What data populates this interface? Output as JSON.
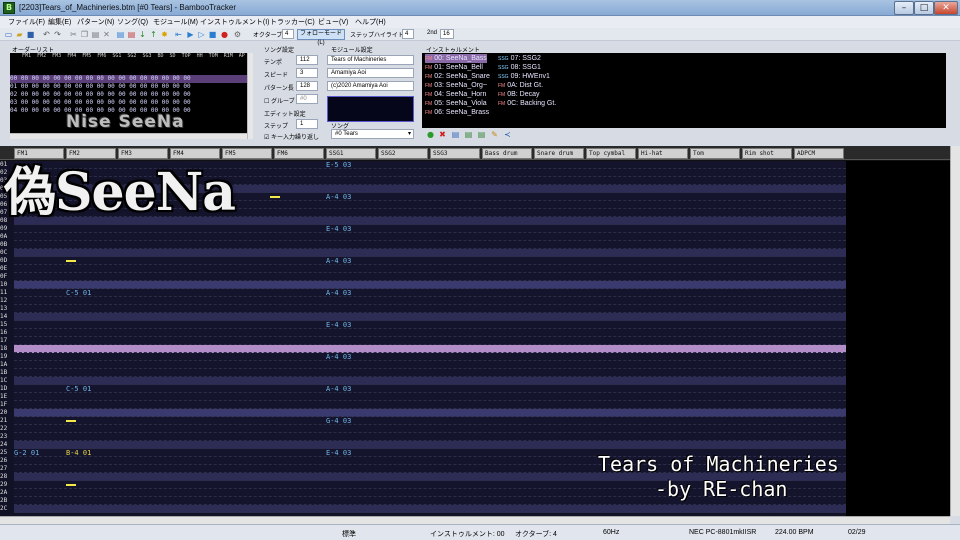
{
  "window": {
    "title": "[2203]Tears_of_Machineries.btm [#0 Tears] - BambooTracker",
    "app_icon": "B"
  },
  "menu": [
    "ファイル(F)",
    "編集(E)",
    "パターン(N)",
    "ソング(Q)",
    "モジュール(M)",
    "インストゥルメント(I)",
    "トラッカー(C)",
    "ビュー(V)",
    "ヘルプ(H)"
  ],
  "toolbar": {
    "octave_label": "オクターブ",
    "octave_value": "4",
    "follow_mode": "フォローモード(L)",
    "step_highlight_label": "ステップハイライト 1st",
    "step_highlight_1st": "4",
    "second_label": "2nd",
    "step_highlight_2nd": "16"
  },
  "order_list": {
    "label": "オーダーリスト",
    "header": "    FM1  FM2  FM3  FM4  FM5  FM6  SG1  SG2  SG3  BD  SD  TOP  HH  TOM  RIM  AP",
    "rows": [
      "00 00 00 00 00 00 00 00 00 00 00 00 00 00 00 00 00",
      "01 00 00 00 00 00 00 00 00 00 00 00 00 00 00 00 00",
      "02 00 00 00 00 00 00 00 00 00 00 00 00 00 00 00 00",
      "03 00 00 00 00 00 00 00 00 00 00 00 00 00 00 00 00",
      "04 00 00 00 00 00 00 00 00 00 00 00 00 00 00 00 00"
    ]
  },
  "song_settings": {
    "label": "ソング設定",
    "tempo_label": "テンポ",
    "tempo": "112",
    "speed_label": "スピード",
    "speed": "3",
    "pattern_len_label": "パターン長",
    "pattern_len": "128",
    "groove_label": "グルーブ",
    "groove": "#0",
    "edit_label": "エディット設定",
    "step_label": "ステップ",
    "step": "1",
    "key_repeat_label": "キー入力繰り返し"
  },
  "module_settings": {
    "label": "モジュール設定",
    "title": "Tears of Machineries",
    "author": "Amamiya Aoi",
    "copyright": "(c)2020 Amamiya Aoi",
    "song_label": "ソング",
    "song": "#0 Tears"
  },
  "instruments": {
    "label": "インストゥルメント",
    "items": [
      {
        "type": "FM",
        "label": "00: SeeNa_Bass",
        "selected": true
      },
      {
        "type": "FM",
        "label": "01: SeeNa_Bell"
      },
      {
        "type": "FM",
        "label": "02: SeeNa_Snare"
      },
      {
        "type": "FM",
        "label": "03: SeeNa_Org~"
      },
      {
        "type": "FM",
        "label": "04: SeeNa_Horn"
      },
      {
        "type": "FM",
        "label": "05: SeeNa_Viola"
      },
      {
        "type": "FM",
        "label": "06: SeeNa_Brass"
      },
      {
        "type": "SSG",
        "label": "07: SSG2"
      },
      {
        "type": "SSG",
        "label": "08: SSG1"
      },
      {
        "type": "SSG",
        "label": "09: HWEnv1"
      },
      {
        "type": "FM",
        "label": "0A: Dist Gt."
      },
      {
        "type": "FM",
        "label": "0B: Decay"
      },
      {
        "type": "FM",
        "label": "0C: Backing Gt."
      }
    ]
  },
  "tracks": [
    "FM1",
    "FM2",
    "FM3",
    "FM4",
    "FM5",
    "FM6",
    "SSG1",
    "SSG2",
    "SSG3",
    "Bass drum",
    "Snare drum",
    "Top cymbal",
    "Hi-hat",
    "Tom",
    "Rim shot",
    "ADPCM"
  ],
  "row_numbers": [
    "01",
    "02",
    "03",
    "04",
    "05",
    "06",
    "07",
    "08",
    "09",
    "0A",
    "0B",
    "0C",
    "0D",
    "0E",
    "0F",
    "10",
    "11",
    "12",
    "13",
    "14",
    "15",
    "16",
    "17",
    "18",
    "19",
    "1A",
    "1B",
    "1C",
    "1D",
    "1E",
    "1F",
    "20",
    "21",
    "22",
    "23",
    "24",
    "25",
    "26",
    "27",
    "28",
    "29",
    "2A",
    "2B",
    "2C"
  ],
  "notes": {
    "e5_top": "E-5 03",
    "a4_1": "A-4 03",
    "e4_1": "E-4 03",
    "a4_2": "A-4 03",
    "c5_1": "C-5 01",
    "a4_3": "A-4 03",
    "e4_2": "E-4 03",
    "a4_4": "A-4 03",
    "c5_2": "C-5 01",
    "a4_5": "A-4 03",
    "g4": "G-4 03",
    "g2": "G-2 01",
    "b4": "B-4 01",
    "e4_3": "E-4 03"
  },
  "overlay": {
    "logo_big": "偽SeeNa",
    "logo_small": "Nise SeeNa",
    "credit_title": "Tears of Machineries",
    "credit_by": "-by RE-chan"
  },
  "status": {
    "mode": "標準",
    "instrument": "インストゥルメント: 00",
    "octave": "オクターブ: 4",
    "rate": "60Hz",
    "system": "NEC PC-8801mkIISR",
    "bpm": "224.00 BPM",
    "position": "02/29"
  },
  "colors": {
    "accent_purple": "#b28dc7",
    "pattern_bg": "#121227",
    "note_yellow": "#e6d24c",
    "note_blue": "#6fb4e8",
    "volume_mark": "#f2e84a"
  }
}
